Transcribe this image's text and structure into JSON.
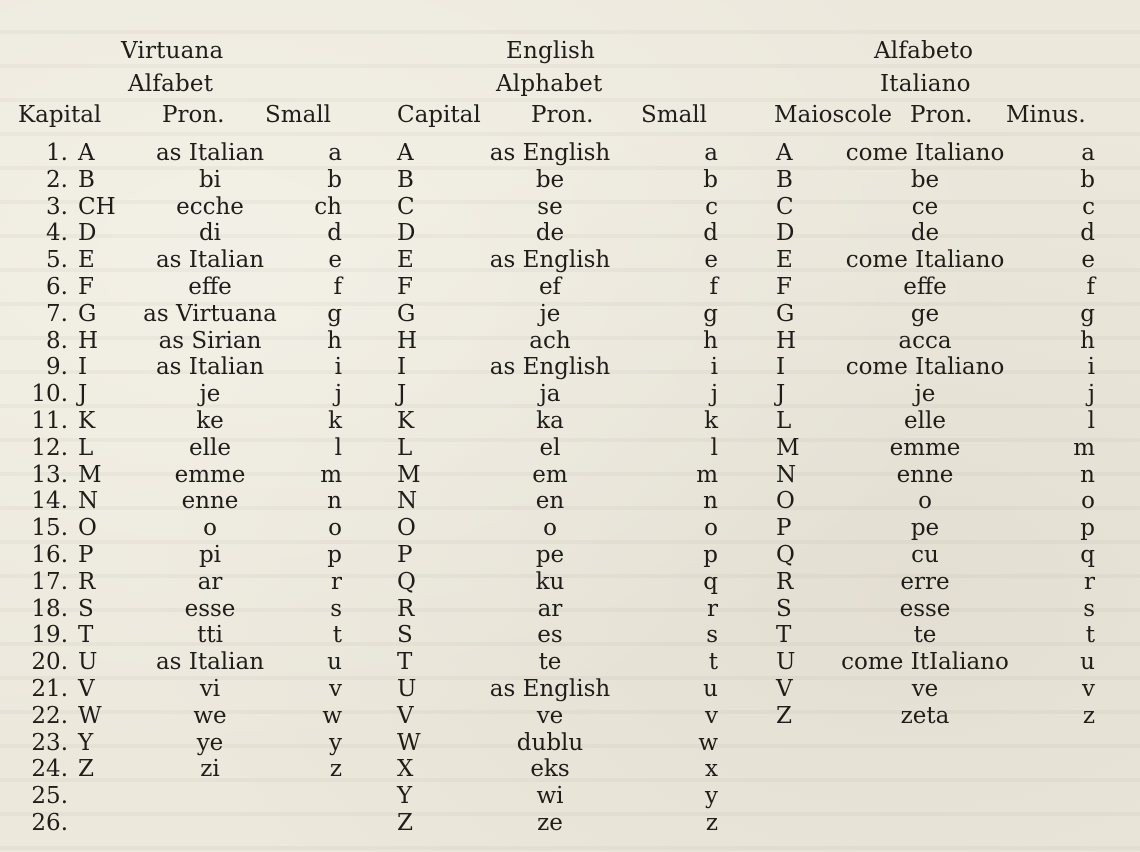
{
  "virtuana": {
    "title_line1": "Virtuana",
    "title_line2": "Alfabet",
    "headers": {
      "capital": "Kapital",
      "pron": "Pron.",
      "small": "Small"
    },
    "rows": [
      {
        "num": "1.",
        "capital": "A",
        "pron": "as Italian",
        "small": "a"
      },
      {
        "num": "2.",
        "capital": "B",
        "pron": "bi",
        "small": "b"
      },
      {
        "num": "3.",
        "capital": "CH",
        "pron": "ecche",
        "small": "ch"
      },
      {
        "num": "4.",
        "capital": "D",
        "pron": "di",
        "small": "d"
      },
      {
        "num": "5.",
        "capital": "E",
        "pron": "as Italian",
        "small": "e"
      },
      {
        "num": "6.",
        "capital": "F",
        "pron": "effe",
        "small": "f"
      },
      {
        "num": "7.",
        "capital": "G",
        "pron": "as Virtuana",
        "small": "g"
      },
      {
        "num": "8.",
        "capital": "H",
        "pron": "as Sirian",
        "small": "h"
      },
      {
        "num": "9.",
        "capital": "I",
        "pron": "as Italian",
        "small": "i"
      },
      {
        "num": "10.",
        "capital": "J",
        "pron": "je",
        "small": "j"
      },
      {
        "num": "11.",
        "capital": "K",
        "pron": "ke",
        "small": "k"
      },
      {
        "num": "12.",
        "capital": "L",
        "pron": "elle",
        "small": "l"
      },
      {
        "num": "13.",
        "capital": "M",
        "pron": "emme",
        "small": "m"
      },
      {
        "num": "14.",
        "capital": "N",
        "pron": "enne",
        "small": "n"
      },
      {
        "num": "15.",
        "capital": "O",
        "pron": "o",
        "small": "o"
      },
      {
        "num": "16.",
        "capital": "P",
        "pron": "pi",
        "small": "p"
      },
      {
        "num": "17.",
        "capital": "R",
        "pron": "ar",
        "small": "r"
      },
      {
        "num": "18.",
        "capital": "S",
        "pron": "esse",
        "small": "s"
      },
      {
        "num": "19.",
        "capital": "T",
        "pron": "tti",
        "small": "t"
      },
      {
        "num": "20.",
        "capital": "U",
        "pron": "as Italian",
        "small": "u"
      },
      {
        "num": "21.",
        "capital": "V",
        "pron": "vi",
        "small": "v"
      },
      {
        "num": "22.",
        "capital": "W",
        "pron": "we",
        "small": "w"
      },
      {
        "num": "23.",
        "capital": "Y",
        "pron": "ye",
        "small": "y"
      },
      {
        "num": "24.",
        "capital": "Z",
        "pron": "zi",
        "small": "z"
      },
      {
        "num": "25.",
        "capital": "",
        "pron": "",
        "small": ""
      },
      {
        "num": "26.",
        "capital": "",
        "pron": "",
        "small": ""
      }
    ]
  },
  "english": {
    "title_line1": "English",
    "title_line2": "Alphabet",
    "headers": {
      "capital": "Capital",
      "pron": "Pron.",
      "small": "Small"
    },
    "rows": [
      {
        "capital": "A",
        "pron": "as English",
        "small": "a"
      },
      {
        "capital": "B",
        "pron": "be",
        "small": "b"
      },
      {
        "capital": "C",
        "pron": "se",
        "small": "c"
      },
      {
        "capital": "D",
        "pron": "de",
        "small": "d"
      },
      {
        "capital": "E",
        "pron": "as English",
        "small": "e"
      },
      {
        "capital": "F",
        "pron": "ef",
        "small": "f"
      },
      {
        "capital": "G",
        "pron": "je",
        "small": "g"
      },
      {
        "capital": "H",
        "pron": "ach",
        "small": "h"
      },
      {
        "capital": "I",
        "pron": "as English",
        "small": "i"
      },
      {
        "capital": "J",
        "pron": "ja",
        "small": "j"
      },
      {
        "capital": "K",
        "pron": "ka",
        "small": "k"
      },
      {
        "capital": "L",
        "pron": "el",
        "small": "l"
      },
      {
        "capital": "M",
        "pron": "em",
        "small": "m"
      },
      {
        "capital": "N",
        "pron": "en",
        "small": "n"
      },
      {
        "capital": "O",
        "pron": "o",
        "small": "o"
      },
      {
        "capital": "P",
        "pron": "pe",
        "small": "p"
      },
      {
        "capital": "Q",
        "pron": "ku",
        "small": "q"
      },
      {
        "capital": "R",
        "pron": "ar",
        "small": "r"
      },
      {
        "capital": "S",
        "pron": "es",
        "small": "s"
      },
      {
        "capital": "T",
        "pron": "te",
        "small": "t"
      },
      {
        "capital": "U",
        "pron": "as English",
        "small": "u"
      },
      {
        "capital": "V",
        "pron": "ve",
        "small": "v"
      },
      {
        "capital": "W",
        "pron": "dublu",
        "small": "w"
      },
      {
        "capital": "X",
        "pron": "eks",
        "small": "x"
      },
      {
        "capital": "Y",
        "pron": "wi",
        "small": "y"
      },
      {
        "capital": "Z",
        "pron": "ze",
        "small": "z"
      }
    ]
  },
  "italiano": {
    "title_line1": "Alfabeto",
    "title_line2": "Italiano",
    "headers": {
      "capital": "Maioscole",
      "pron": "Pron.",
      "small": "Minus."
    },
    "rows": [
      {
        "capital": "A",
        "pron": "come Italiano",
        "small": "a"
      },
      {
        "capital": "B",
        "pron": "be",
        "small": "b"
      },
      {
        "capital": "C",
        "pron": "ce",
        "small": "c"
      },
      {
        "capital": "D",
        "pron": "de",
        "small": "d"
      },
      {
        "capital": "E",
        "pron": "come Italiano",
        "small": "e"
      },
      {
        "capital": "F",
        "pron": "effe",
        "small": "f"
      },
      {
        "capital": "G",
        "pron": "ge",
        "small": "g"
      },
      {
        "capital": "H",
        "pron": "acca",
        "small": "h"
      },
      {
        "capital": "I",
        "pron": "come Italiano",
        "small": "i"
      },
      {
        "capital": "J",
        "pron": "je",
        "small": "j"
      },
      {
        "capital": "L",
        "pron": "elle",
        "small": "l"
      },
      {
        "capital": "M",
        "pron": "emme",
        "small": "m"
      },
      {
        "capital": "N",
        "pron": "enne",
        "small": "n"
      },
      {
        "capital": "O",
        "pron": "o",
        "small": "o"
      },
      {
        "capital": "P",
        "pron": "pe",
        "small": "p"
      },
      {
        "capital": "Q",
        "pron": "cu",
        "small": "q"
      },
      {
        "capital": "R",
        "pron": "erre",
        "small": "r"
      },
      {
        "capital": "S",
        "pron": "esse",
        "small": "s"
      },
      {
        "capital": "T",
        "pron": "te",
        "small": "t"
      },
      {
        "capital": "U",
        "pron": "come ItIaliano",
        "small": "u"
      },
      {
        "capital": "V",
        "pron": "ve",
        "small": "v"
      },
      {
        "capital": "Z",
        "pron": "zeta",
        "small": "z"
      }
    ]
  }
}
